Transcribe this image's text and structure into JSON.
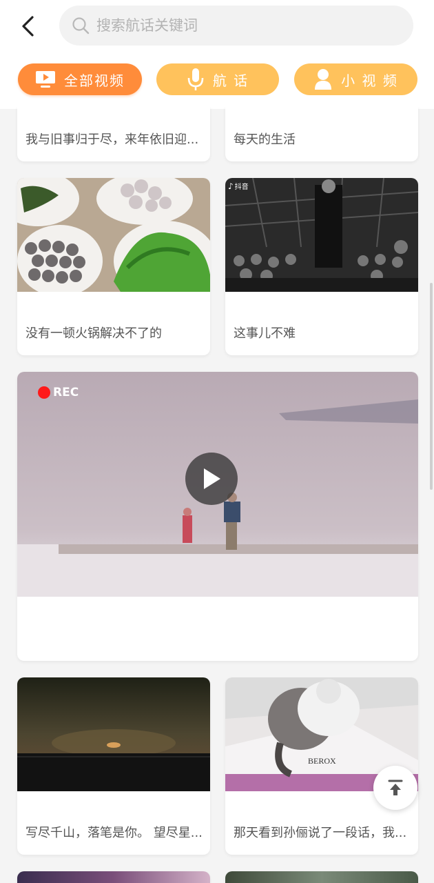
{
  "header": {
    "back_icon": "chevron-left-icon",
    "search_placeholder": "搜索航话关键词"
  },
  "tabs": [
    {
      "label": "全部视频",
      "icon": "video-icon",
      "active": true
    },
    {
      "label": "航 话",
      "icon": "microphone-icon",
      "active": false
    },
    {
      "label": "小 视 频",
      "icon": "person-icon",
      "active": false
    }
  ],
  "feed": {
    "row1": [
      {
        "title": "我与旧事归于尽，来年依旧迎..."
      },
      {
        "title": "每天的生活"
      }
    ],
    "row2": [
      {
        "title": "没有一顿火锅解决不了的"
      },
      {
        "title": "这事儿不难",
        "overlay": "抖音"
      }
    ],
    "featured": {
      "badge": "REC",
      "title": ""
    },
    "row3": [
      {
        "title": "写尽千山，落笔是你。 望尽星..."
      },
      {
        "title": "那天看到孙俪说了一段话，我..."
      }
    ]
  },
  "back_to_top_icon": "arrow-up-icon",
  "colors": {
    "accent": "#ff8c3a",
    "tab_inactive": "#ffc25c"
  }
}
